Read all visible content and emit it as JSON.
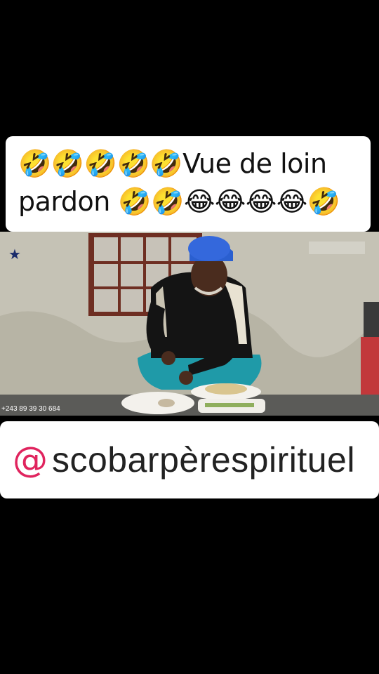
{
  "caption": {
    "line1": "🤣🤣🤣🤣🤣Vue de loin",
    "line2": "pardon 🤣🤣😂😂😂😂🤣"
  },
  "video": {
    "phone_overlay": "+243 89 39 30 684",
    "star_icon": "star-icon"
  },
  "handle": {
    "at_symbol": "@",
    "username": "scobarpèrespirituel",
    "at_color": "#e0245e"
  }
}
